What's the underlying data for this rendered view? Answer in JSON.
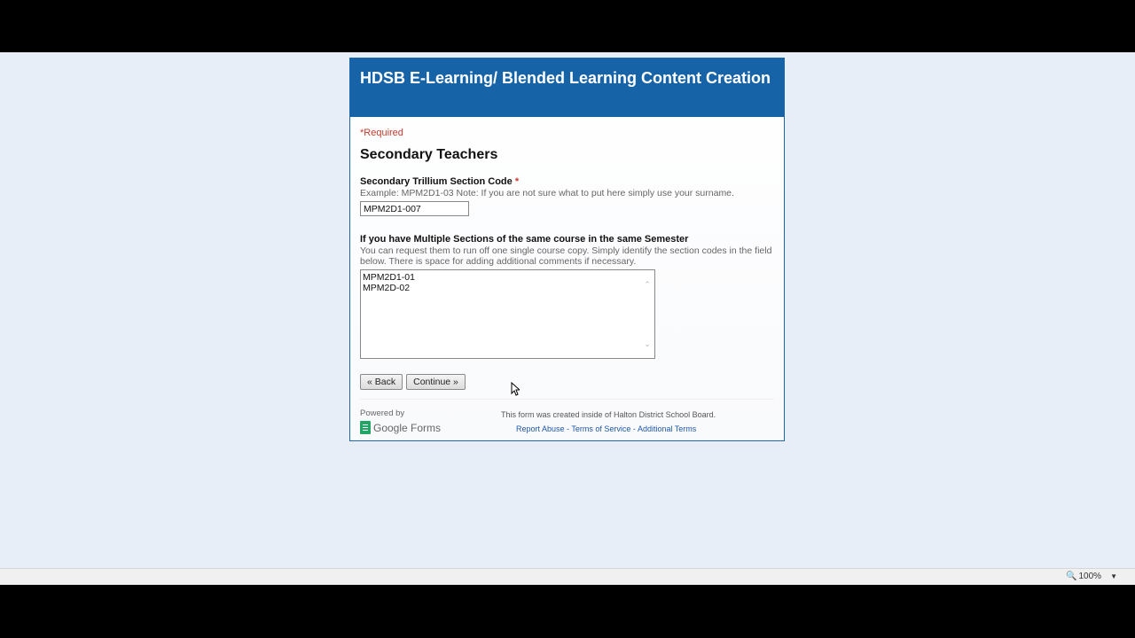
{
  "form": {
    "title": "HDSB E-Learning/ Blended Learning Content Creation",
    "required_note": "*Required",
    "page_title": "Secondary Teachers",
    "q1": {
      "title": "Secondary Trillium Section Code",
      "required_mark": "*",
      "help": "Example: MPM2D1-03 Note: If you are not sure what to put here simply use your surname.",
      "value": "MPM2D1-007"
    },
    "q2": {
      "title": "If you have Multiple Sections of the same course in the same Semester",
      "help": "You can request them to run off one single course copy. Simply identify the section codes in the field below. There is space for adding additional comments if necessary.",
      "value": "MPM2D1-01\nMPM2D-02"
    },
    "buttons": {
      "back": "« Back",
      "continue": "Continue »"
    },
    "footer": {
      "powered_by": "Powered by",
      "brand_google": "Google",
      "brand_forms": "Forms",
      "created_note": "This form was created inside of Halton District School Board.",
      "link_report": "Report Abuse",
      "link_terms": "Terms of Service",
      "link_additional": "Additional Terms",
      "separator": " - "
    }
  },
  "statusbar": {
    "zoom": "100%"
  },
  "colors": {
    "header_blue": "#1763a8",
    "required_red": "#c43b2e",
    "link_blue": "#1f57a8",
    "page_bg": "#e8eef7",
    "google_forms_green": "#23a566"
  }
}
